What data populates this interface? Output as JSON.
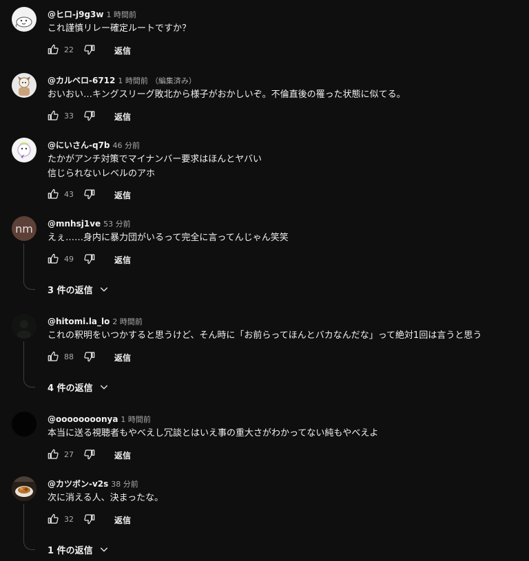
{
  "reply_label": "返信",
  "comments": [
    {
      "author": "@ヒロ-j9g3w",
      "time": "1 時間前",
      "edited": "",
      "text": [
        "これ謹慎リレー確定ルートですか？"
      ],
      "likes": "22",
      "avatar": "seal-avatar-icon"
    },
    {
      "author": "@カルベロ-6712",
      "time": "1 時間前",
      "edited": "（編集済み）",
      "text": [
        "おいおい…キングスリーグ敗北から様子がおかしいぞ。不倫直後の罹った状態に似てる。"
      ],
      "likes": "33",
      "avatar": "character-avatar-icon"
    },
    {
      "author": "@にいさん-q7b",
      "time": "46 分前",
      "edited": "",
      "text": [
        "たかがアンチ対策でマイナンバー要求はほんとヤバい",
        "信じられないレベルのアホ"
      ],
      "likes": "43",
      "avatar": "cartoon-avatar-icon"
    },
    {
      "author": "@mnhsj1ve",
      "time": "53 分前",
      "edited": "",
      "text": [
        "えぇ……身内に暴力団がいるって完全に言ってんじゃん笑笑"
      ],
      "likes": "49",
      "avatar_initials": "nm",
      "replies": "3 件の返信"
    },
    {
      "author": "@hitomi.la_lo",
      "time": "2 時間前",
      "edited": "",
      "text": [
        "これの釈明をいつかすると思うけど、そん時に「お前らってほんとバカなんだな」って絶対1回は言うと思う"
      ],
      "likes": "88",
      "avatar": "dark-photo-avatar-icon",
      "replies": "4 件の返信"
    },
    {
      "author": "@oooooooonya",
      "time": "1 時間前",
      "edited": "",
      "text": [
        "本当に送る視聴者もやべえし冗談とはいえ事の重大さがわかってない純もやべえよ"
      ],
      "likes": "27",
      "avatar": "black-avatar-icon"
    },
    {
      "author": "@カツボン-v2s",
      "time": "38 分前",
      "edited": "",
      "text": [
        "次に消える人、決まったな。"
      ],
      "likes": "32",
      "avatar": "food-photo-avatar-icon",
      "replies": "1 件の返信"
    }
  ],
  "colors": {
    "background": "#0f0f0f",
    "text": "#f1f1f1",
    "secondary": "#aaaaaa",
    "thread_line": "#3f3f3f"
  }
}
